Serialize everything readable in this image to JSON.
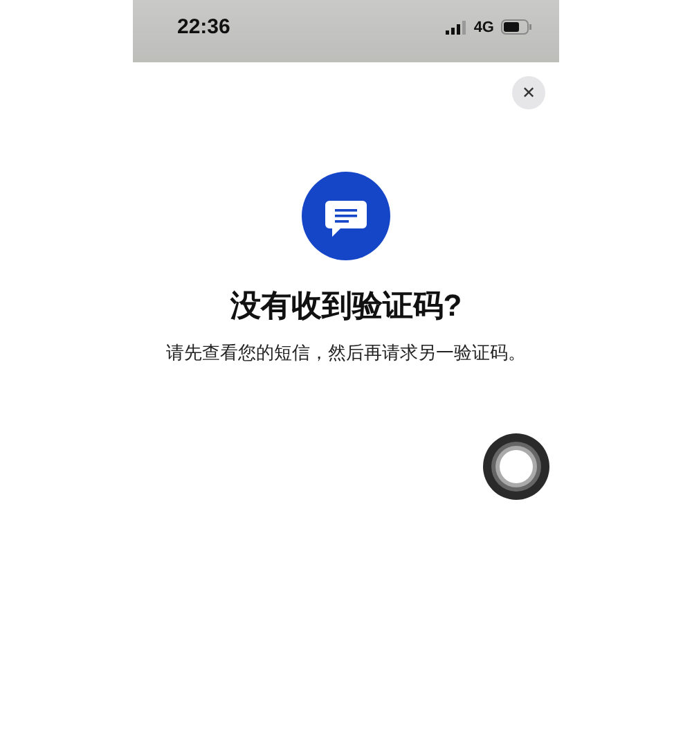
{
  "status_bar": {
    "time": "22:36",
    "network": "4G"
  },
  "dialog": {
    "close_label": "✕",
    "title": "没有收到验证码?",
    "message": "请先查看您的短信，然后再请求另一验证码。"
  }
}
